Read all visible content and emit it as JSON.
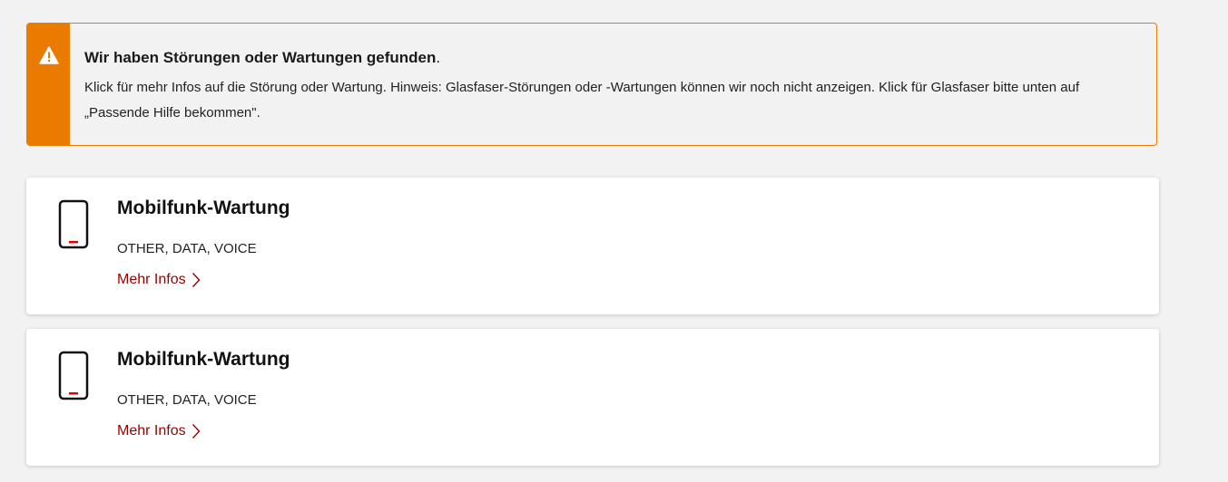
{
  "alert": {
    "icon": "warning-icon",
    "title": "Wir haben Störungen oder Wartungen gefunden",
    "title_suffix": ".",
    "line1": "Klick für mehr Infos auf die Störung oder Wartung. Hinweis: Glasfaser-Störungen oder  -Wartungen können wir noch nicht anzeigen. Klick für Glasfaser bitte unten auf",
    "line2": "„Passende Hilfe bekommen\".",
    "colors": {
      "accent": "#eb7b00"
    }
  },
  "incidents": [
    {
      "icon": "mobile-phone-icon",
      "title": "Mobilfunk-Wartung",
      "tags": "OTHER, DATA, VOICE",
      "link_label": "Mehr Infos",
      "link_icon": "chevron-right-icon"
    },
    {
      "icon": "mobile-phone-icon",
      "title": "Mobilfunk-Wartung",
      "tags": "OTHER, DATA, VOICE",
      "link_label": "Mehr Infos",
      "link_icon": "chevron-right-icon"
    }
  ],
  "colors": {
    "background": "#f2f2f2",
    "link": "#990000",
    "phone_indicator": "#e60000"
  }
}
